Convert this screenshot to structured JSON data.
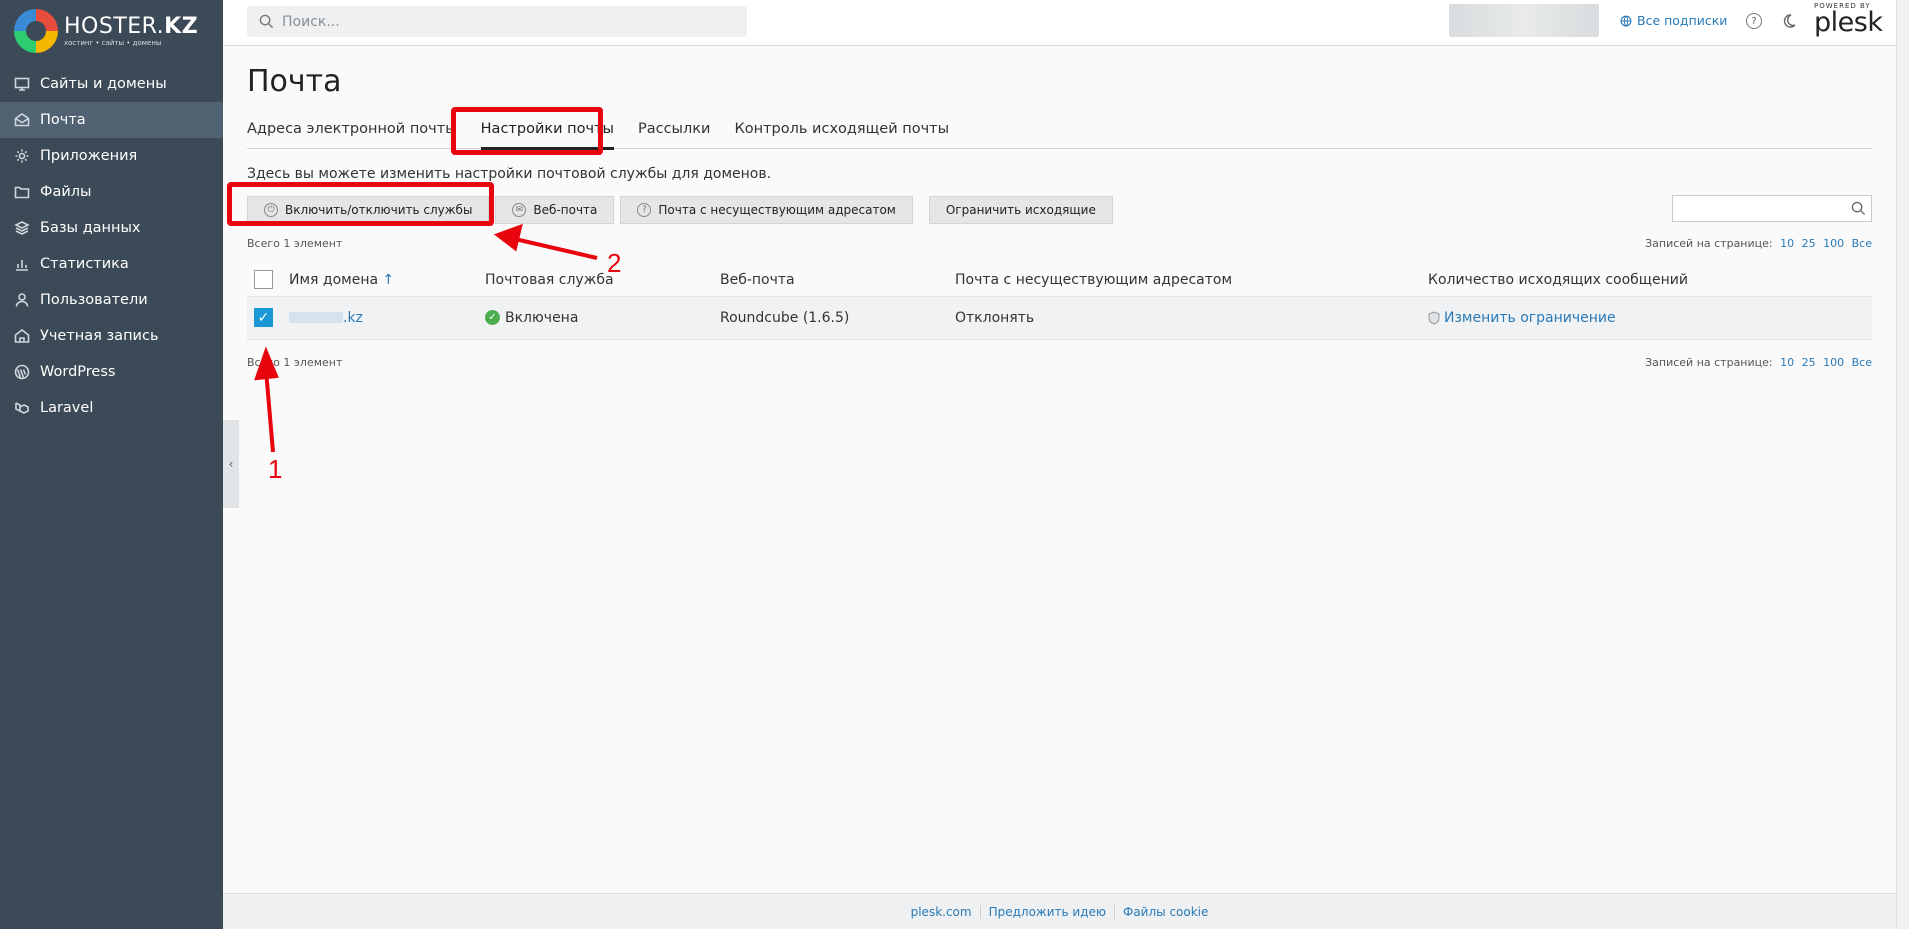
{
  "brand": {
    "title_plain": "HOSTER.",
    "title_bold": "KZ",
    "subtitle": "хостинг • сайты • домены"
  },
  "sidebar": {
    "items": [
      {
        "label": "Сайты и домены",
        "icon": "monitor-icon",
        "active": false
      },
      {
        "label": "Почта",
        "icon": "mail-icon",
        "active": true
      },
      {
        "label": "Приложения",
        "icon": "gear-icon",
        "active": false
      },
      {
        "label": "Файлы",
        "icon": "folder-icon",
        "active": false
      },
      {
        "label": "Базы данных",
        "icon": "database-icon",
        "active": false
      },
      {
        "label": "Статистика",
        "icon": "bar-chart-icon",
        "active": false
      },
      {
        "label": "Пользователи",
        "icon": "user-icon",
        "active": false
      },
      {
        "label": "Учетная запись",
        "icon": "account-icon",
        "active": false
      },
      {
        "label": "WordPress",
        "icon": "wordpress-icon",
        "active": false
      },
      {
        "label": "Laravel",
        "icon": "laravel-icon",
        "active": false
      }
    ]
  },
  "header": {
    "search_placeholder": "Поиск...",
    "subscriptions_label": "Все подписки",
    "powered_by": "POWERED BY",
    "plesk": "plesk"
  },
  "main": {
    "title": "Почта",
    "tabs": [
      {
        "label": "Адреса электронной почты"
      },
      {
        "label": "Настройки почты"
      },
      {
        "label": "Рассылки"
      },
      {
        "label": "Контроль исходящей почты"
      }
    ],
    "description": "Здесь вы можете изменить настройки почтовой службы для доменов.",
    "toolbar": {
      "toggle_services": "Включить/отключить службы",
      "webmail": "Веб-почта",
      "nonexistent": "Почта с несуществующим адресатом",
      "limit_outgoing": "Ограничить исходящие"
    },
    "total_label": "Всего 1 элемент",
    "per_page_label": "Записей на странице:",
    "per_page_options": [
      "10",
      "25",
      "100",
      "Все"
    ],
    "table": {
      "headers": [
        "Имя домена",
        "Почтовая служба",
        "Веб-почта",
        "Почта с несуществующим адресатом",
        "Количество исходящих сообщений"
      ],
      "sort_arrow": "↑",
      "rows": [
        {
          "domain": ".kz",
          "mail_service": "Включена",
          "webmail": "Roundcube (1.6.5)",
          "nonexistent": "Отклонять",
          "outgoing": "Изменить ограничение"
        }
      ]
    }
  },
  "annotations": {
    "one": "1",
    "two": "2",
    "color": "#e8050d"
  },
  "footer": {
    "links": [
      "plesk.com",
      "Предложить идею",
      "Файлы cookie"
    ]
  },
  "colors": {
    "sidebar": "#3b4a56",
    "sidebar_active": "#516373",
    "link": "#2a7ab8",
    "accent_check": "#1a98d6",
    "ok": "#4cae4c"
  }
}
